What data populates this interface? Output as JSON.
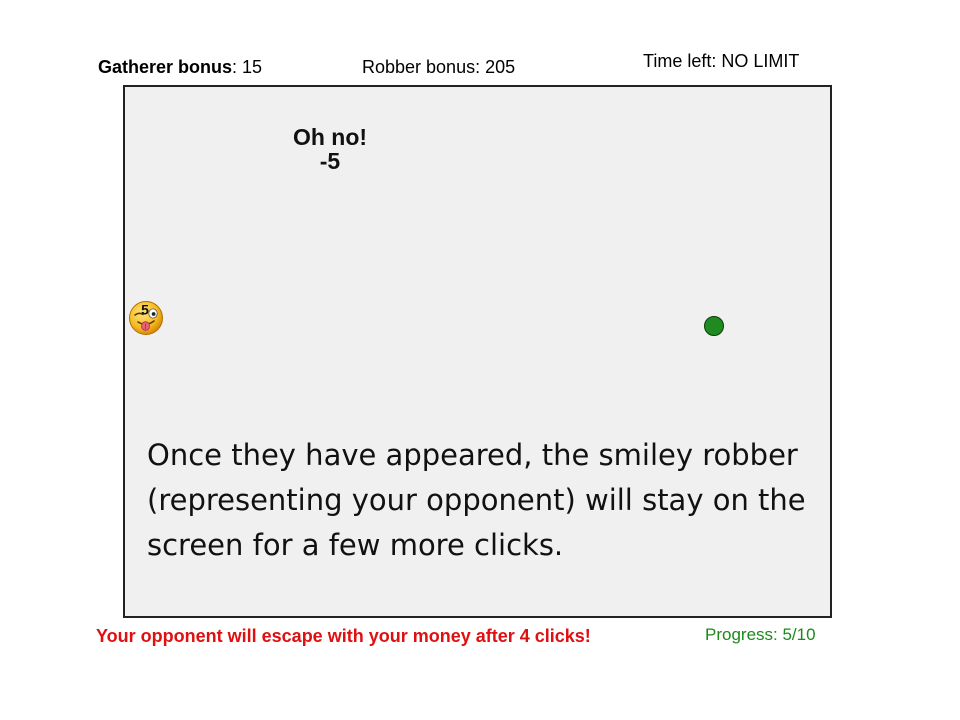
{
  "hud": {
    "gatherer_label": "Gatherer bonus",
    "gatherer_sep": ": ",
    "gatherer_value": "15",
    "robber_text": "Robber bonus: 205",
    "time_text": "Time left: NO LIMIT"
  },
  "arena": {
    "feedback_title": "Oh no!",
    "feedback_delta": "-5",
    "robber_countdown": "5",
    "instruction": "Once they have appeared, the smiley robber (representing your opponent) will stay on the screen for a few more clicks."
  },
  "footer": {
    "escape_warning": "Your opponent will  escape with  your money after 4 clicks!",
    "progress": "Progress: 5/10"
  },
  "colors": {
    "coin": "#1f8a1f",
    "warning": "#e01010",
    "progress": "#1a8a1a",
    "arena_bg": "#f0f0f0"
  },
  "icons": {
    "robber": "tongue-wink-smiley-icon",
    "coin": "green-dot-icon"
  }
}
